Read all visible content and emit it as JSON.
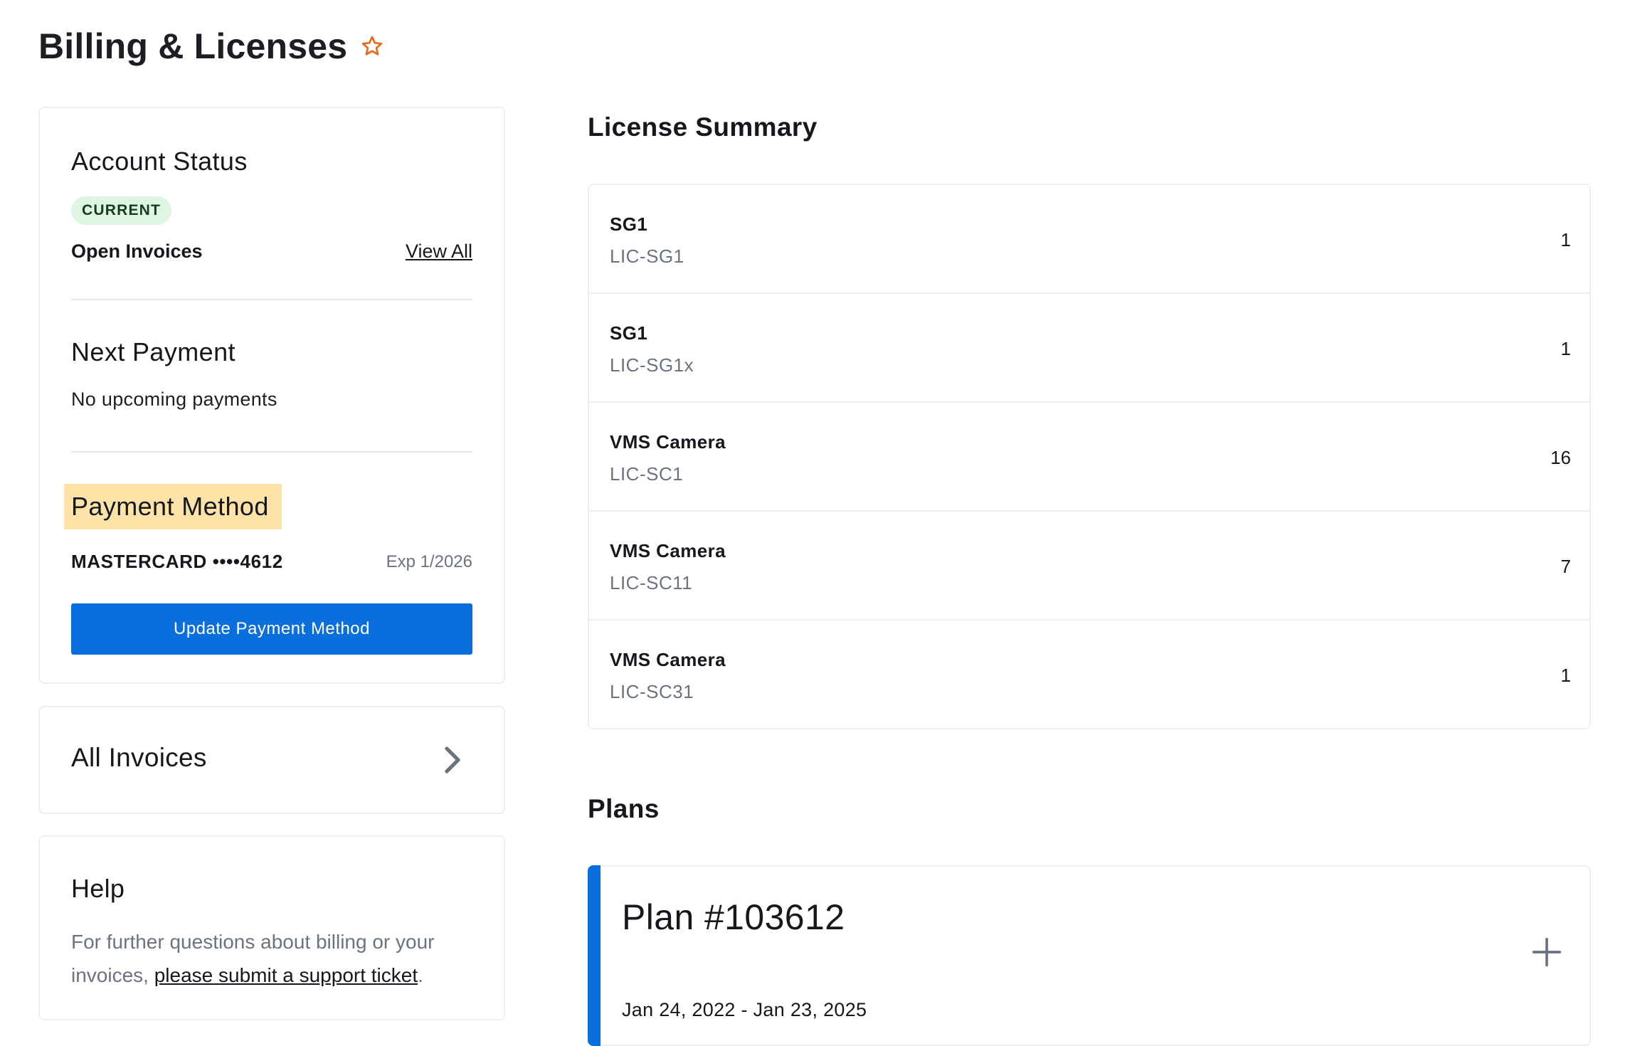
{
  "page": {
    "title": "Billing & Licenses",
    "favorite_icon": "star-outline-icon",
    "accent_color": "#e36a1d"
  },
  "account_status": {
    "title": "Account Status",
    "badge": "CURRENT",
    "open_invoices_label": "Open Invoices",
    "view_all_link": "View All"
  },
  "next_payment": {
    "title": "Next Payment",
    "text": "No upcoming payments"
  },
  "payment_method": {
    "title": "Payment Method",
    "card": "MASTERCARD ••••4612",
    "expiry": "Exp 1/2026",
    "update_button": "Update Payment Method",
    "button_color": "#0a6fdd"
  },
  "all_invoices": {
    "title": "All Invoices",
    "icon": "chevron-right-icon"
  },
  "help": {
    "title": "Help",
    "text_before": "For further questions about billing or your invoices, ",
    "link": "please submit a support ticket",
    "text_after": "."
  },
  "license_summary": {
    "title": "License Summary",
    "items": [
      {
        "name": "SG1",
        "code": "LIC-SG1",
        "count": "1"
      },
      {
        "name": "SG1",
        "code": "LIC-SG1x",
        "count": "1"
      },
      {
        "name": "VMS Camera",
        "code": "LIC-SC1",
        "count": "16"
      },
      {
        "name": "VMS Camera",
        "code": "LIC-SC11",
        "count": "7"
      },
      {
        "name": "VMS Camera",
        "code": "LIC-SC31",
        "count": "1"
      }
    ]
  },
  "plans": {
    "title": "Plans",
    "items": [
      {
        "title": "Plan #103612",
        "dates": "Jan 24, 2022 - Jan 23, 2025",
        "expand_icon": "plus-icon"
      }
    ]
  }
}
